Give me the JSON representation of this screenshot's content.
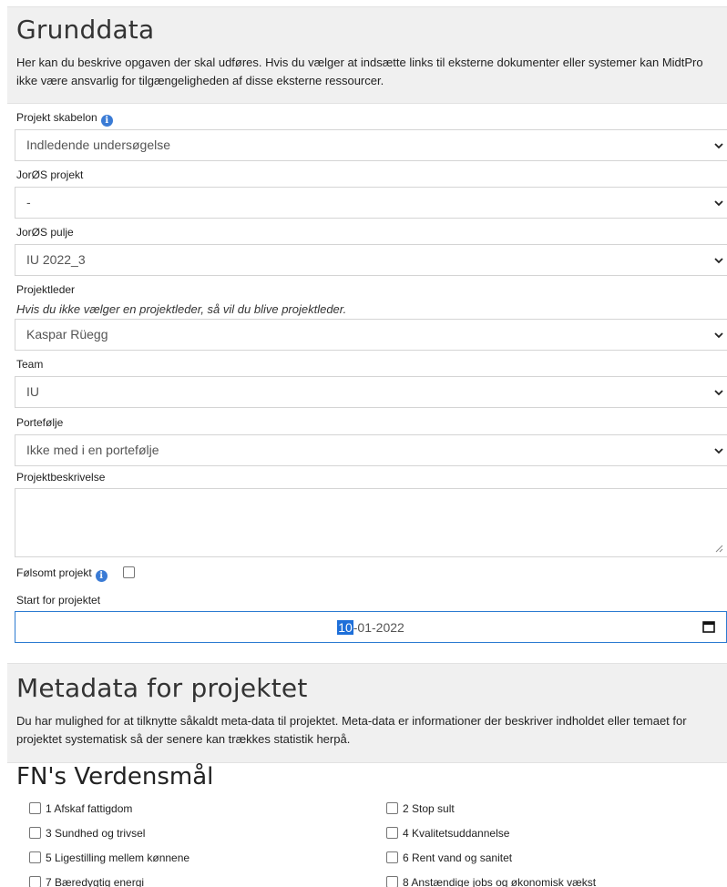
{
  "grunddata": {
    "title": "Grunddata",
    "description": "Her kan du beskrive opgaven der skal udføres. Hvis du vælger at indsætte links til eksterne dokumenter eller systemer kan MidtPro ikke være ansvarlig for tilgængeligheden af disse eksterne ressourcer."
  },
  "fields": {
    "skabelon": {
      "label": "Projekt skabelon",
      "value": "Indledende undersøgelse"
    },
    "jorosprojekt": {
      "label": "JorØS projekt",
      "value": "-"
    },
    "jorospulje": {
      "label": "JorØS pulje",
      "value": "IU 2022_3"
    },
    "projektleder": {
      "label": "Projektleder",
      "hint": "Hvis du ikke vælger en projektleder, så vil du blive projektleder.",
      "value": "Kaspar Rüegg"
    },
    "team": {
      "label": "Team",
      "value": "IU"
    },
    "portefolje": {
      "label": "Portefølje",
      "value": "Ikke med i en portefølje"
    },
    "beskrivelse": {
      "label": "Projektbeskrivelse",
      "value": ""
    },
    "folsomt": {
      "label": "Følsomt projekt"
    },
    "start": {
      "label": "Start for projektet",
      "day": "10",
      "rest": "-01-2022"
    }
  },
  "metadata": {
    "title": "Metadata for projektet",
    "description": "Du har mulighed for at tilknytte såkaldt meta-data til projektet. Meta-data er informationer der beskriver indholdet eller temaet for projektet systematisk så der senere kan trækkes statistik herpå."
  },
  "goals": {
    "title": "FN's Verdensmål",
    "items": [
      "1 Afskaf fattigdom",
      "2 Stop sult",
      "3 Sundhed og trivsel",
      "4 Kvalitetsuddannelse",
      "5 Ligestilling mellem kønnene",
      "6 Rent vand og sanitet",
      "7 Bæredygtig energi",
      "8 Anstændige jobs og økonomisk vækst"
    ]
  },
  "colors": {
    "panel": "#f0f0f0",
    "focus": "#2c7bd1",
    "info": "#3a7bd5"
  }
}
